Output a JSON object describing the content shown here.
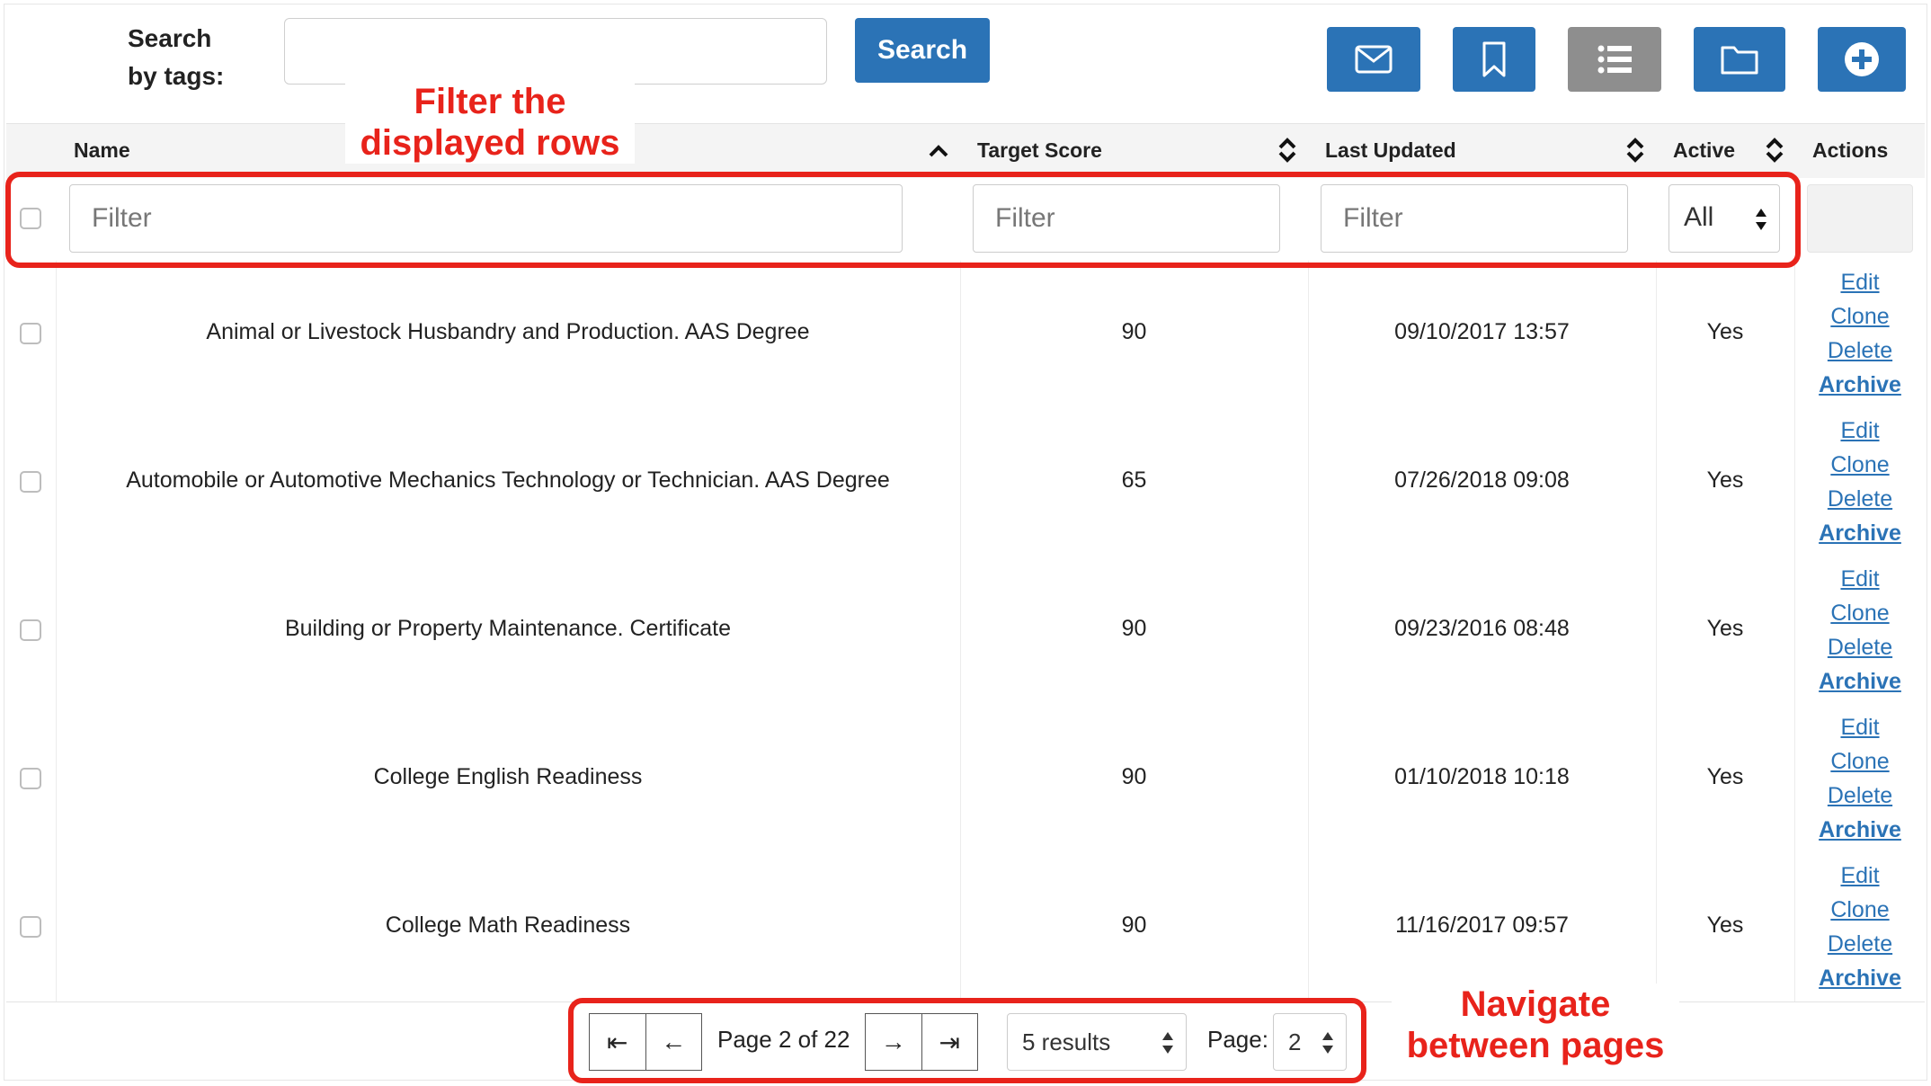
{
  "toolbar": {
    "search_label_line1": "Search",
    "search_label_line2": "by tags:",
    "search_value": "",
    "search_button": "Search",
    "icon_buttons": [
      {
        "icon": "mail-icon",
        "color": "#2b73b6"
      },
      {
        "icon": "bookmark-icon",
        "color": "#2b73b6"
      },
      {
        "icon": "list-icon",
        "color": "#8e8e8e"
      },
      {
        "icon": "folder-icon",
        "color": "#2b73b6"
      },
      {
        "icon": "plus-circle-icon",
        "color": "#2b73b6"
      }
    ]
  },
  "table": {
    "columns": [
      "Name",
      "Target Score",
      "Last Updated",
      "Active",
      "Actions"
    ],
    "filters": {
      "name_placeholder": "Filter",
      "score_placeholder": "Filter",
      "updated_placeholder": "Filter",
      "active_value": "All"
    },
    "rows": [
      {
        "name": "Animal or Livestock Husbandry and Production. AAS Degree",
        "score": "90",
        "updated": "09/10/2017 13:57",
        "active": "Yes"
      },
      {
        "name": "Automobile or Automotive Mechanics Technology or Technician. AAS Degree",
        "score": "65",
        "updated": "07/26/2018 09:08",
        "active": "Yes"
      },
      {
        "name": "Building or Property Maintenance. Certificate",
        "score": "90",
        "updated": "09/23/2016 08:48",
        "active": "Yes"
      },
      {
        "name": "College English Readiness",
        "score": "90",
        "updated": "01/10/2018 10:18",
        "active": "Yes"
      },
      {
        "name": "College Math Readiness",
        "score": "90",
        "updated": "11/16/2017 09:57",
        "active": "Yes"
      }
    ],
    "actions": [
      "Edit",
      "Clone",
      "Delete",
      "Archive"
    ]
  },
  "pagination": {
    "first": "⇤",
    "prev": "←",
    "next": "→",
    "last": "⇥",
    "page_info": "Page 2 of 22",
    "results_value": "5 results",
    "page_label": "Page:",
    "page_value": "2"
  },
  "annotations": {
    "filter_line1": "Filter the",
    "filter_line2": "displayed rows",
    "nav_line1": "Navigate",
    "nav_line2": "between pages",
    "color": "#e8231b"
  },
  "colors": {
    "primary": "#2b73b6",
    "gray_button": "#8e8e8e",
    "header_bg": "#f4f4f4"
  }
}
